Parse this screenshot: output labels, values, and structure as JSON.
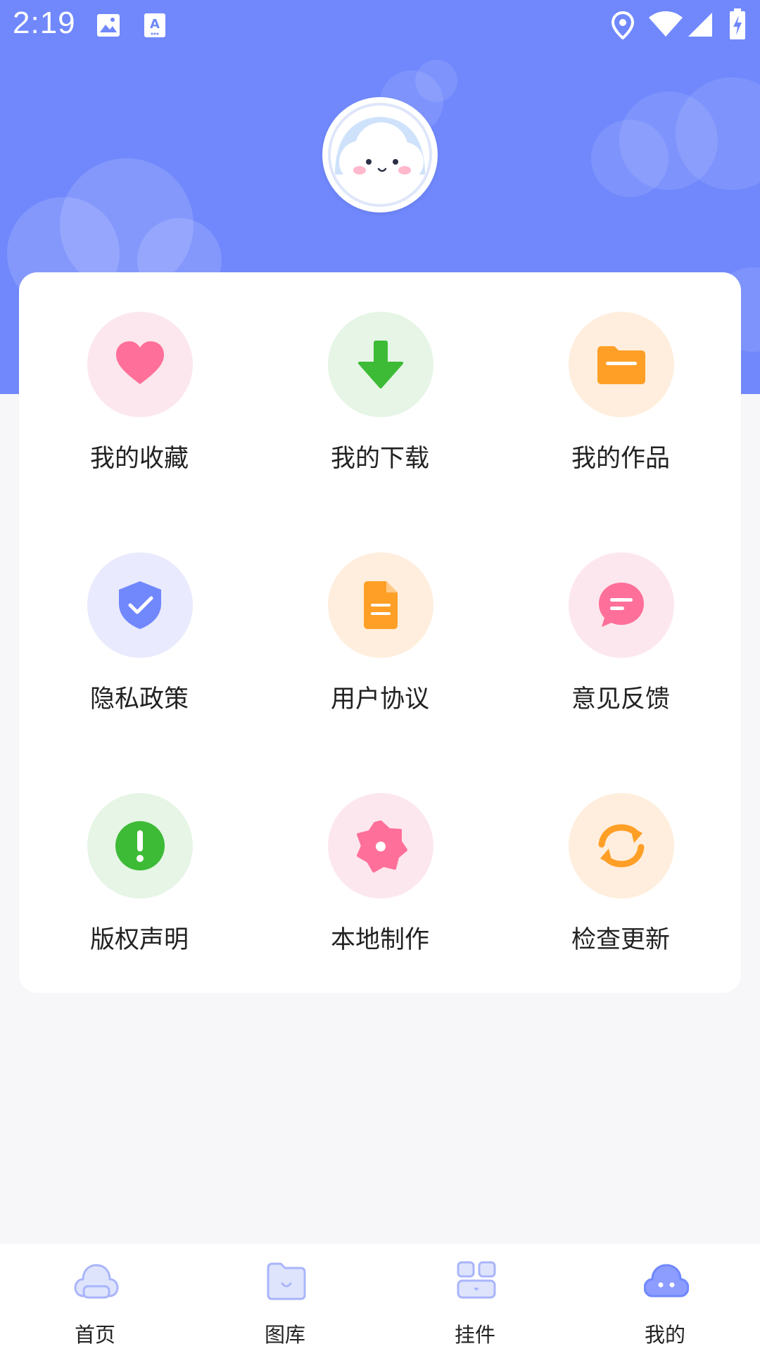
{
  "status_bar": {
    "time": "2:19",
    "left_icons": [
      "image-icon",
      "text-a-icon"
    ],
    "right_icons": [
      "location-icon",
      "wifi-icon",
      "signal-icon",
      "battery-charging-icon"
    ]
  },
  "profile": {
    "avatar_icon": "cloud-face-icon"
  },
  "menu": {
    "items": [
      {
        "label": "我的收藏",
        "icon": "heart-icon",
        "bg": "#fde7ee",
        "color": "#fe6f99"
      },
      {
        "label": "我的下载",
        "icon": "download-icon",
        "bg": "#e6f5e6",
        "color": "#3dbb36"
      },
      {
        "label": "我的作品",
        "icon": "folder-icon",
        "bg": "#ffeedd",
        "color": "#ff9f26"
      },
      {
        "label": "隐私政策",
        "icon": "shield-check-icon",
        "bg": "#e9eafe",
        "color": "#7088fc"
      },
      {
        "label": "用户协议",
        "icon": "document-icon",
        "bg": "#ffeedd",
        "color": "#ff9f26"
      },
      {
        "label": "意见反馈",
        "icon": "chat-icon",
        "bg": "#fde7ee",
        "color": "#fe6f99"
      },
      {
        "label": "版权声明",
        "icon": "exclamation-icon",
        "bg": "#e6f5e6",
        "color": "#3dbb36"
      },
      {
        "label": "本地制作",
        "icon": "flower-icon",
        "bg": "#fde7ee",
        "color": "#fe6f99"
      },
      {
        "label": "检查更新",
        "icon": "refresh-icon",
        "bg": "#ffeedd",
        "color": "#ff9f26"
      }
    ]
  },
  "bottom_nav": {
    "tabs": [
      {
        "label": "首页",
        "icon": "cloud-home-icon",
        "active": false
      },
      {
        "label": "图库",
        "icon": "folder-gallery-icon",
        "active": false
      },
      {
        "label": "挂件",
        "icon": "widgets-icon",
        "active": false
      },
      {
        "label": "我的",
        "icon": "cloud-face-icon",
        "active": true
      }
    ],
    "inactive_color": "#a9b5fb",
    "active_color": "#7088fc"
  },
  "colors": {
    "header_blue": "#7088fc",
    "page_bg": "#f7f7f9"
  }
}
